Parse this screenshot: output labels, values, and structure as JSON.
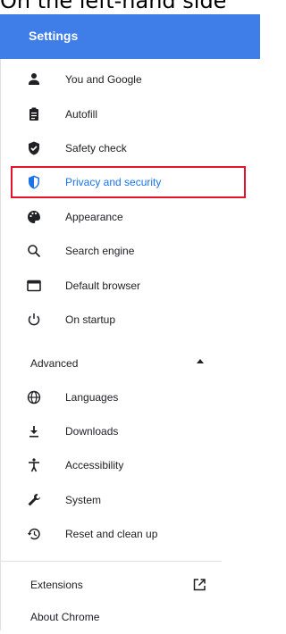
{
  "caption": "On the left-hand side",
  "header": {
    "title": "Settings"
  },
  "menu": {
    "items": [
      {
        "label": "You and Google",
        "icon": "person-icon"
      },
      {
        "label": "Autofill",
        "icon": "clipboard-icon"
      },
      {
        "label": "Safety check",
        "icon": "shield-check-icon"
      },
      {
        "label": "Privacy and security",
        "icon": "shield-icon",
        "active": true
      },
      {
        "label": "Appearance",
        "icon": "palette-icon"
      },
      {
        "label": "Search engine",
        "icon": "search-icon"
      },
      {
        "label": "Default browser",
        "icon": "browser-window-icon"
      },
      {
        "label": "On startup",
        "icon": "power-icon"
      }
    ],
    "advanced_label": "Advanced",
    "advanced_items": [
      {
        "label": "Languages",
        "icon": "globe-icon"
      },
      {
        "label": "Downloads",
        "icon": "download-icon"
      },
      {
        "label": "Accessibility",
        "icon": "accessibility-icon"
      },
      {
        "label": "System",
        "icon": "wrench-icon"
      },
      {
        "label": "Reset and clean up",
        "icon": "restore-icon"
      }
    ]
  },
  "footer": {
    "extensions_label": "Extensions",
    "about_label": "About Chrome"
  },
  "colors": {
    "header_bg": "#3f7de8",
    "active_text": "#1a73e8",
    "highlight_box": "#e3132b"
  }
}
